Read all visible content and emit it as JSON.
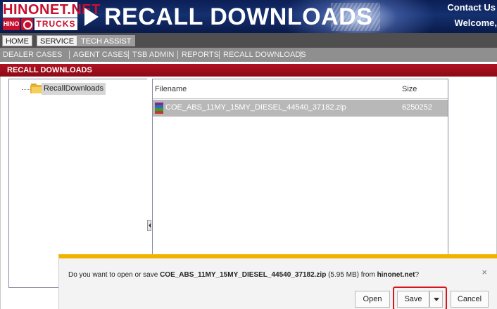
{
  "header": {
    "logo": {
      "brand_text": "HINONET.NET",
      "hino_tag": "HINO",
      "trucks_text": "TRUCKS"
    },
    "title": "RECALL DOWNLOADS",
    "contact_us": "Contact Us",
    "welcome": "Welcome,"
  },
  "nav_primary": {
    "items": [
      {
        "label": "HOME",
        "active": false
      },
      {
        "label": "SERVICE",
        "active": false
      },
      {
        "label": "TECH ASSIST",
        "active": true
      }
    ]
  },
  "nav_secondary": {
    "items": [
      "DEALER CASES",
      "AGENT CASES",
      "TSB ADMIN",
      "REPORTS",
      "RECALL DOWNLOADS"
    ]
  },
  "section": {
    "title": "RECALL DOWNLOADS"
  },
  "tree": {
    "folder_label": "RecallDownloads",
    "folder_icon": "folder-icon"
  },
  "files": {
    "columns": {
      "filename": "Filename",
      "size": "Size"
    },
    "rows": [
      {
        "name": "COE_ABS_11MY_15MY_DIESEL_44540_37182.zip",
        "size": "6250252",
        "icon": "archive-icon",
        "selected": true
      }
    ]
  },
  "download_bar": {
    "prompt_prefix": "Do you want to open or save ",
    "file_name": "COE_ABS_11MY_15MY_DIESEL_44540_37182.zip",
    "file_size": " (5.95 MB) from ",
    "source": "hinonet.net",
    "prompt_suffix": "?",
    "close_symbol": "×",
    "buttons": {
      "open": "Open",
      "save": "Save",
      "cancel": "Cancel"
    }
  },
  "colors": {
    "banner": "#14306f",
    "brand_red": "#c8102e",
    "section_bar": "#b01222",
    "download_bar_accent": "#f0b400",
    "highlight": "#d9141f"
  }
}
